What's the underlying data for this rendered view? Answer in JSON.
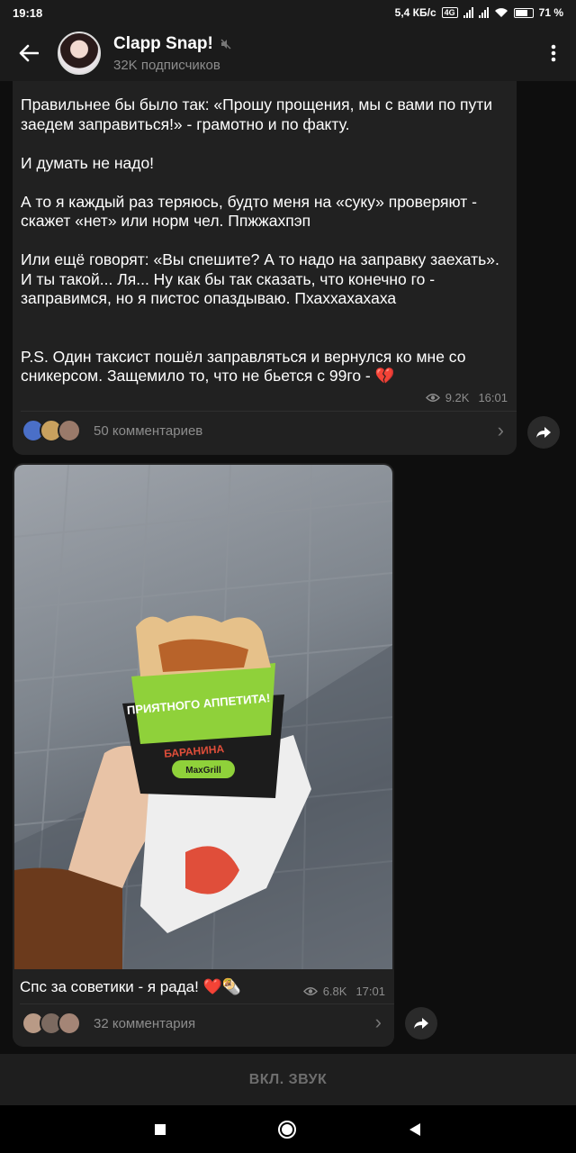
{
  "status_bar": {
    "time": "19:18",
    "net_speed": "5,4 КБ/с",
    "network_badge": "4G",
    "battery": "71 %"
  },
  "header": {
    "title": "Clapp Snap!",
    "subtitle": "32K подписчиков",
    "muted_icon": "muted-speaker-icon"
  },
  "post1": {
    "text": "Правильнее бы было так: «Прошу прощения, мы с вами по пути заедем заправиться!» - грамотно и по факту.\n\nИ думать не надо!\n\nА то я каждый раз теряюсь, будто меня на «суку» проверяют - скажет «нет» или норм чел. Ппжжахпэп\n\nИли ещё говорят: «Вы спешите? А то надо на заправку заехать». И ты такой... Ля... Ну как бы так сказать, что конечно го - заправимся, но я пистос опаздываю. Пхаххахахаха\n\n\nP.S. Один таксист пошёл заправляться и вернулся ко мне со сникерсом. Защемило то, что не бьется с 99го - 💔",
    "views": "9.2K",
    "time": "16:01",
    "comments": "50 комментариев"
  },
  "post2": {
    "photo_text_1": "ПРИЯТНОГО АППЕТИТА!",
    "photo_text_2": "БАРАНИНА",
    "photo_text_3": "MaxGrill",
    "caption": "Спс за советики - я рада! ❤️🌯",
    "views": "6.8K",
    "time": "17:01",
    "comments": "32 комментария"
  },
  "mute_bar": {
    "label": "ВКЛ. ЗВУК"
  },
  "colors": {
    "bg": "#0e0e0e",
    "bubble": "#212121",
    "header": "#1b1b1b",
    "muted_text": "#8d8d8d"
  }
}
